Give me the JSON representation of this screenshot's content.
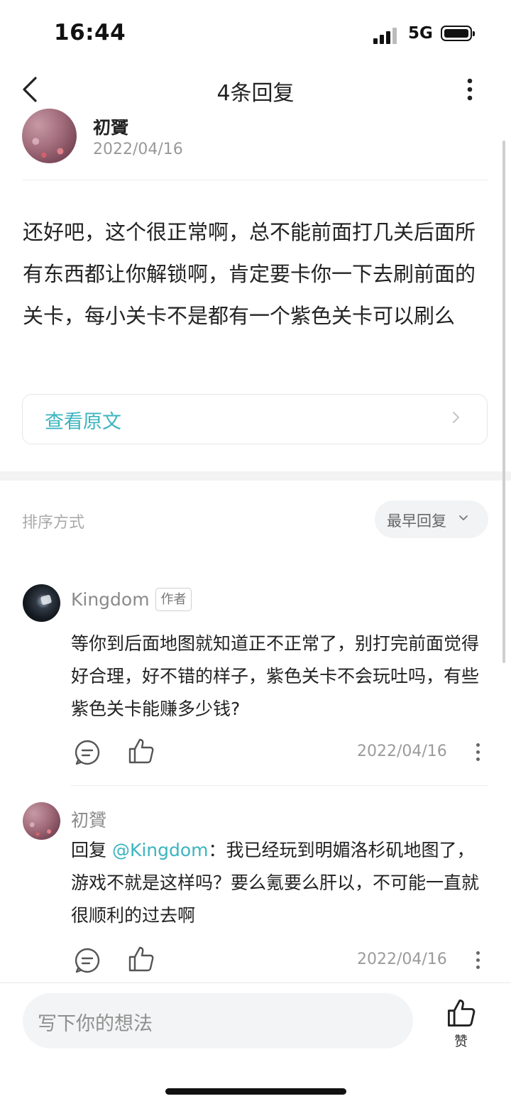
{
  "status_bar": {
    "time": "16:44",
    "network": "5G"
  },
  "header": {
    "title": "4条回复"
  },
  "post": {
    "author": "初贇",
    "date": "2022/04/16",
    "content": "还好吧，这个很正常啊，总不能前面打几关后面所有东西都让你解锁啊，肯定要卡你一下去刷前面的关卡，每小关卡不是都有一个紫色关卡可以刷么",
    "view_original": "查看原文"
  },
  "sort": {
    "label": "排序方式",
    "selected": "最早回复"
  },
  "replies": [
    {
      "name": "Kingdom",
      "badge": "作者",
      "content": "等你到后面地图就知道正不正常了，别打完前面觉得好合理，好不错的样子，紫色关卡不会玩吐吗，有些紫色关卡能赚多少钱?",
      "date": "2022/04/16"
    },
    {
      "name": "初贇",
      "reply_prefix": "回复 ",
      "mention": "@Kingdom",
      "content": "：我已经玩到明媚洛杉矶地图了，游戏不就是这样吗？要么氪要么肝以，不可能一直就很顺利的过去啊",
      "date": "2022/04/16"
    }
  ],
  "bottom": {
    "input_placeholder": "写下你的想法",
    "like_label": "赞"
  },
  "colors": {
    "accent": "#3cb4bf",
    "muted": "#9b9b9b"
  }
}
